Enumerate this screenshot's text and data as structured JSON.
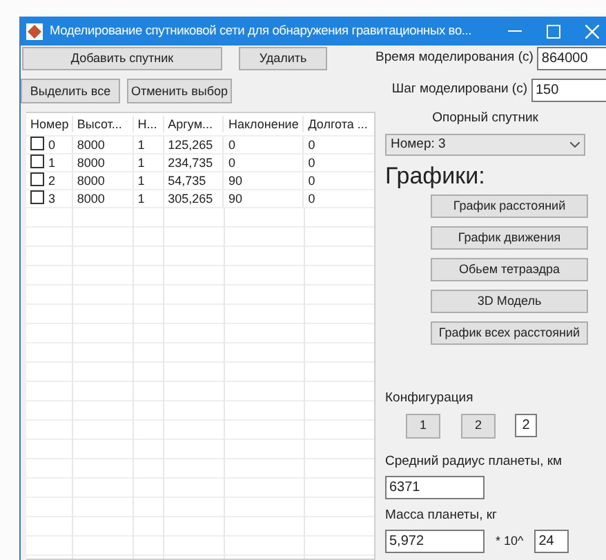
{
  "window": {
    "title": "Моделирование спутниковой сети для обнаружения гравитационных во..."
  },
  "toolbar": {
    "add_button": "Добавить спутник",
    "delete_button": "Удалить",
    "select_all_button": "Выделить все",
    "deselect_button": "Отменить выбор"
  },
  "params": [
    {
      "label": "Время моделирования (с)",
      "value": "864000"
    },
    {
      "label": "Шаг моделировани (с)",
      "value": "150"
    }
  ],
  "table": {
    "columns": [
      "Номер",
      "Высот...",
      "Н...",
      "Аргум...",
      "Наклонение",
      "Долгота ..."
    ],
    "rows": [
      {
        "checked": false,
        "cells": [
          "0",
          "8000",
          "1",
          "125,265",
          "0",
          "0"
        ]
      },
      {
        "checked": false,
        "cells": [
          "1",
          "8000",
          "1",
          "234,735",
          "0",
          "0"
        ]
      },
      {
        "checked": false,
        "cells": [
          "2",
          "8000",
          "1",
          "54,735",
          "90",
          "0"
        ]
      },
      {
        "checked": false,
        "cells": [
          "3",
          "8000",
          "1",
          "305,265",
          "90",
          "0"
        ]
      }
    ]
  },
  "reference": {
    "label": "Опорный спутник",
    "value": "Номер: 3"
  },
  "charts": {
    "heading": "Графики:",
    "buttons": [
      "График расстояний",
      "График движения",
      "Обьем тетраэдра",
      "3D Модель",
      "График всех расстояний"
    ]
  },
  "configuration": {
    "label": "Конфигурация",
    "buttons": [
      "1",
      "2"
    ],
    "value": "2"
  },
  "radius": {
    "label": "Средний радиус планеты, км",
    "value": "6371"
  },
  "mass": {
    "label": "Масса планеты, кг",
    "mantissa": "5,972",
    "operator": "* 10^",
    "exponent": "24"
  }
}
